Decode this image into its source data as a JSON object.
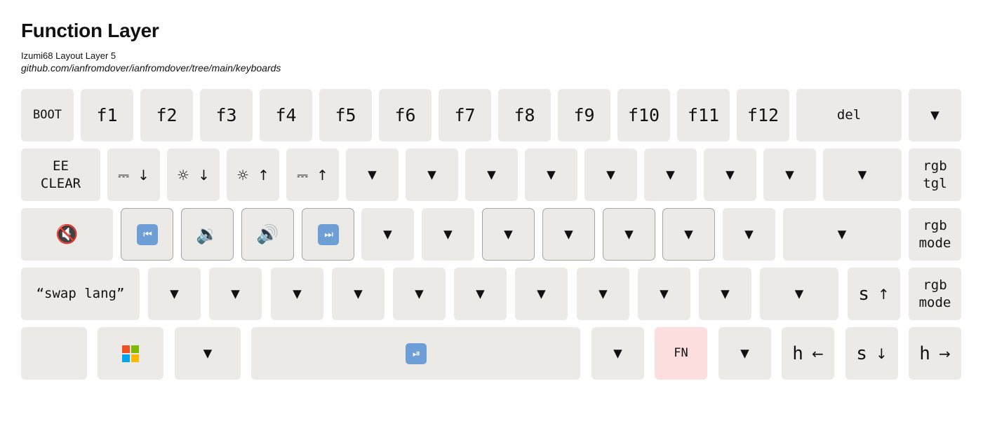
{
  "header": {
    "title": "Function Layer",
    "subtitle": "Izumi68 Layout Layer 5",
    "link": "github.com/ianfromdover/ianfromdover/tree/main/keyboards"
  },
  "keys": {
    "boot": "BOOT",
    "f1": "f1",
    "f2": "f2",
    "f3": "f3",
    "f4": "f4",
    "f5": "f5",
    "f6": "f6",
    "f7": "f7",
    "f8": "f8",
    "f9": "f9",
    "f10": "f10",
    "f11": "f11",
    "f12": "f12",
    "del": "del",
    "transparent": "▼",
    "ee_clear": "EE\nCLEAR",
    "rgb_tgl": "rgb\ntgl",
    "rgb_mode": "rgb\nmode",
    "swap_lang": "“swap lang”",
    "fn": "FN",
    "s": "s",
    "h": "h",
    "arrow_up": "↑",
    "arrow_down": "↓",
    "arrow_left": "←",
    "arrow_right": "→",
    "brightness_icon": "☼",
    "display_icon": "⎓",
    "mute_icon": "🔇",
    "vol_down_icon": "🔉",
    "vol_up_icon": "🔊",
    "prev_track": "⏮",
    "next_track": "⏭",
    "play_pause": "⏯",
    "apple_logo": ""
  },
  "colors": {
    "key": "#ebeae7",
    "fn_key": "#fddede",
    "outline": "#a4a4a4"
  }
}
